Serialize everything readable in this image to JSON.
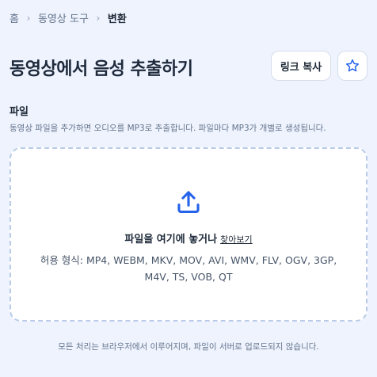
{
  "breadcrumb": {
    "items": [
      "홈",
      "동영상 도구",
      "변환"
    ],
    "separator": "›"
  },
  "header": {
    "title": "동영상에서 음성 추출하기",
    "copy_link_label": "링크 복사",
    "favorite_icon": "star-icon"
  },
  "upload": {
    "label": "파일",
    "description": "동영상 파일을 추가하면 오디오를 MP3로 추출합니다. 파일마다 MP3가 개별로 생성됩니다.",
    "icon": "upload-icon",
    "prompt": "파일을 여기에 놓거나",
    "browse_label": "찾아보기",
    "formats": "허용 형식: MP4, WEBM, MKV, MOV, AVI, WMV, FLV, OGV, 3GP, M4V, TS, VOB, QT"
  },
  "footnote": "모든 처리는 브라우저에서 이루어지며, 파일이 서버로 업로드되지 않습니다.",
  "colors": {
    "background": "#eef3fe",
    "accent": "#2563eb",
    "dropzone_border": "#b9cbe8"
  }
}
